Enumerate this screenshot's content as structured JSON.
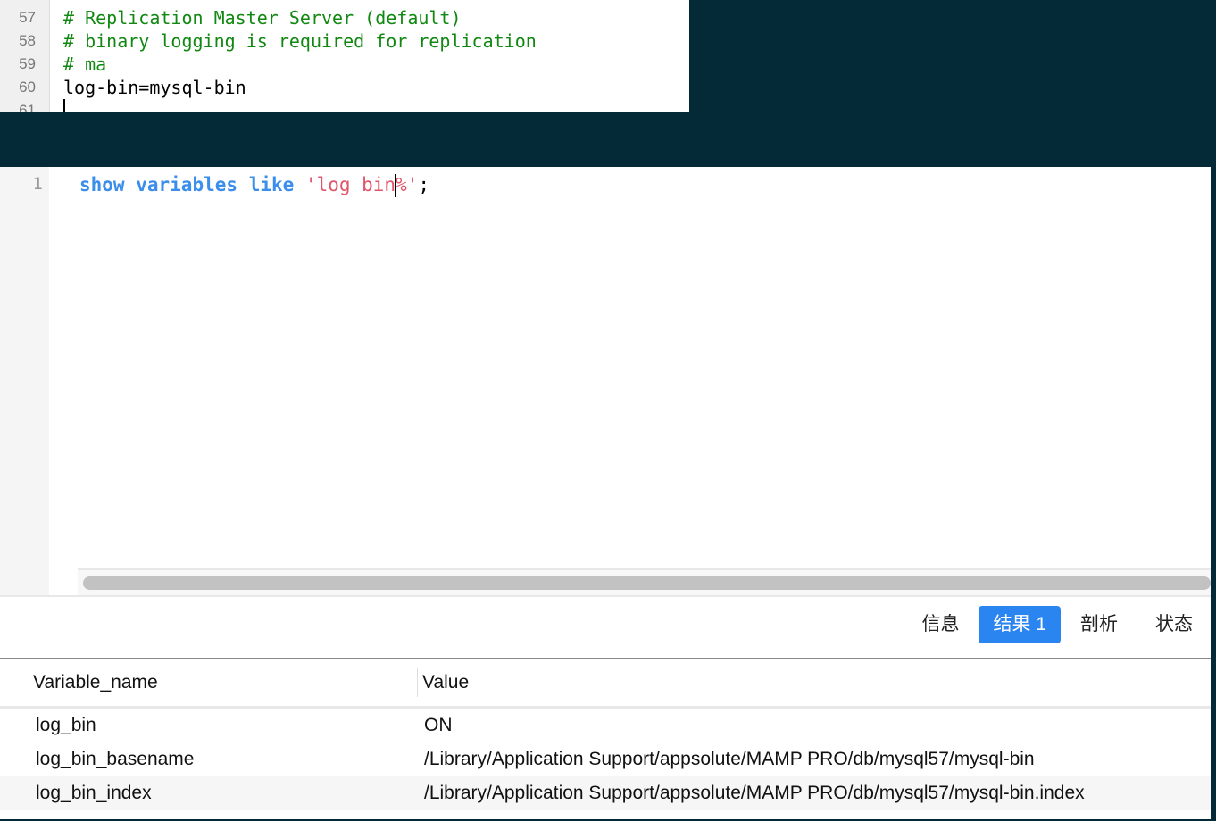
{
  "config_editor": {
    "lines": [
      {
        "num": "57",
        "text": "# Replication Master Server (default)",
        "type": "comment"
      },
      {
        "num": "58",
        "text": "# binary logging is required for replication",
        "type": "comment"
      },
      {
        "num": "59",
        "text": "# ma",
        "type": "comment"
      },
      {
        "num": "60",
        "text": "log-bin=mysql-bin",
        "type": "code"
      },
      {
        "num": "61",
        "text": "",
        "type": "code"
      }
    ]
  },
  "query_editor": {
    "line_number": "1",
    "kw1": "show",
    "kw2": "variables",
    "kw3": "like",
    "string_before_caret": "'log_bin",
    "string_after_caret": "%'",
    "terminator": ";"
  },
  "result_tabs": [
    {
      "label": "信息"
    },
    {
      "label": "结果 1",
      "active": true
    },
    {
      "label": "剖析"
    },
    {
      "label": "状态"
    }
  ],
  "table": {
    "columns": [
      "Variable_name",
      "Value"
    ],
    "rows": [
      [
        "log_bin",
        "ON"
      ],
      [
        "log_bin_basename",
        "/Library/Application Support/appsolute/MAMP PRO/db/mysql57/mysql-bin"
      ],
      [
        "log_bin_index",
        "/Library/Application Support/appsolute/MAMP PRO/db/mysql57/mysql-bin.index"
      ]
    ]
  },
  "colors": {
    "accent": "#2b85f0",
    "background": "#032a36",
    "comment": "#118811",
    "keyword": "#3b8eea",
    "string": "#e0556a"
  }
}
